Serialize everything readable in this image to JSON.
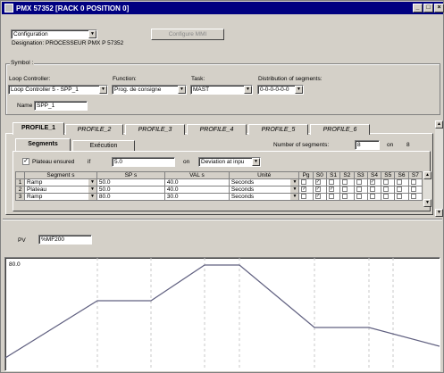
{
  "window": {
    "title": "PMX 57352 [RACK 0    POSITION 0]"
  },
  "top": {
    "mode_combo": "Configuration",
    "configure_button": "Configure MMI",
    "designation": "Designation: PROCESSEUR PMX P 57352"
  },
  "symbol": {
    "group_label": "Symbol :",
    "loop_controller_label": "Loop Controller:",
    "loop_controller_value": "Loop Controller 5 - SPP_1",
    "function_label": "Function:",
    "function_value": "Prog. de consigne",
    "task_label": "Task:",
    "task_value": "MAST",
    "distribution_label": "Distribution of segments:",
    "distribution_value": "0-0-0-0-0-0",
    "name_label": "Name",
    "name_value": "SPP_1"
  },
  "profile_tabs": [
    "PROFILE_1",
    "PROFILE_2",
    "PROFILE_3",
    "PROFILE_4",
    "PROFILE_5",
    "PROFILE_6"
  ],
  "segments": {
    "subtabs": [
      "Segments",
      "Exécution"
    ],
    "number_label": "Number of segments:",
    "number_value": "8",
    "on_label": "on",
    "on_value": "8",
    "plateau_label": "Plateau ensured",
    "plateau_symbol": "if",
    "plateau_value": "5.0",
    "plateau_on": "on",
    "deviation_value": "Deviation at inpu",
    "columns": [
      "Segment s",
      "SP s",
      "VAL s",
      "Unité",
      "Pg",
      "S0",
      "S1",
      "S2",
      "S3",
      "S4",
      "S5",
      "S6",
      "S7"
    ],
    "rows": [
      {
        "n": "1",
        "seg": "Ramp",
        "sp": "50.0",
        "val": "40.0",
        "unit": "Seconds",
        "checks": [
          "",
          "✓",
          "",
          "",
          "",
          "✓",
          "",
          "",
          ""
        ]
      },
      {
        "n": "2",
        "seg": "Plateau",
        "sp": "50.0",
        "val": "40.0",
        "unit": "Seconds",
        "checks": [
          "✓",
          "✓",
          "✓",
          "",
          "",
          "",
          "",
          "",
          ""
        ]
      },
      {
        "n": "3",
        "seg": "Ramp",
        "sp": "80.0",
        "val": "30.0",
        "unit": "Seconds",
        "checks": [
          "",
          "✓",
          "",
          "",
          "",
          "",
          "",
          "",
          ""
        ]
      }
    ]
  },
  "graph": {
    "pv_label": "PV",
    "pv_value": "%MF200",
    "ymax_label": "80.0"
  },
  "colors": {
    "titlebar": "#000080",
    "face": "#d4d0c8",
    "plot_line": "#606080"
  }
}
